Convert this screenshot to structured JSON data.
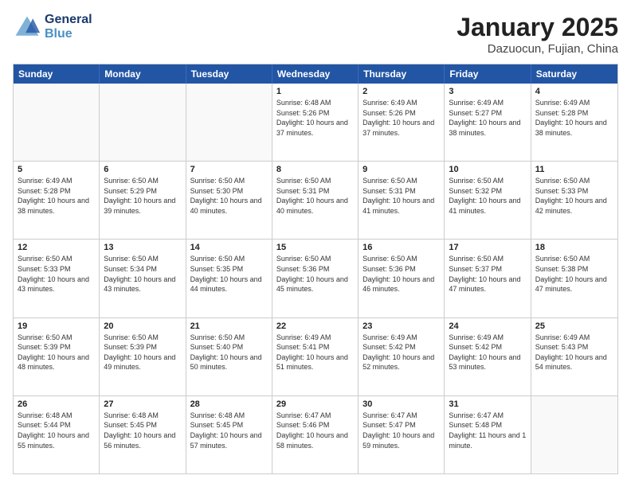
{
  "header": {
    "logo_general": "General",
    "logo_blue": "Blue",
    "title": "January 2025",
    "subtitle": "Dazuocun, Fujian, China"
  },
  "days_of_week": [
    "Sunday",
    "Monday",
    "Tuesday",
    "Wednesday",
    "Thursday",
    "Friday",
    "Saturday"
  ],
  "weeks": [
    [
      {
        "day": "",
        "sunrise": "",
        "sunset": "",
        "daylight": ""
      },
      {
        "day": "",
        "sunrise": "",
        "sunset": "",
        "daylight": ""
      },
      {
        "day": "",
        "sunrise": "",
        "sunset": "",
        "daylight": ""
      },
      {
        "day": "1",
        "sunrise": "Sunrise: 6:48 AM",
        "sunset": "Sunset: 5:26 PM",
        "daylight": "Daylight: 10 hours and 37 minutes."
      },
      {
        "day": "2",
        "sunrise": "Sunrise: 6:49 AM",
        "sunset": "Sunset: 5:26 PM",
        "daylight": "Daylight: 10 hours and 37 minutes."
      },
      {
        "day": "3",
        "sunrise": "Sunrise: 6:49 AM",
        "sunset": "Sunset: 5:27 PM",
        "daylight": "Daylight: 10 hours and 38 minutes."
      },
      {
        "day": "4",
        "sunrise": "Sunrise: 6:49 AM",
        "sunset": "Sunset: 5:28 PM",
        "daylight": "Daylight: 10 hours and 38 minutes."
      }
    ],
    [
      {
        "day": "5",
        "sunrise": "Sunrise: 6:49 AM",
        "sunset": "Sunset: 5:28 PM",
        "daylight": "Daylight: 10 hours and 38 minutes."
      },
      {
        "day": "6",
        "sunrise": "Sunrise: 6:50 AM",
        "sunset": "Sunset: 5:29 PM",
        "daylight": "Daylight: 10 hours and 39 minutes."
      },
      {
        "day": "7",
        "sunrise": "Sunrise: 6:50 AM",
        "sunset": "Sunset: 5:30 PM",
        "daylight": "Daylight: 10 hours and 40 minutes."
      },
      {
        "day": "8",
        "sunrise": "Sunrise: 6:50 AM",
        "sunset": "Sunset: 5:31 PM",
        "daylight": "Daylight: 10 hours and 40 minutes."
      },
      {
        "day": "9",
        "sunrise": "Sunrise: 6:50 AM",
        "sunset": "Sunset: 5:31 PM",
        "daylight": "Daylight: 10 hours and 41 minutes."
      },
      {
        "day": "10",
        "sunrise": "Sunrise: 6:50 AM",
        "sunset": "Sunset: 5:32 PM",
        "daylight": "Daylight: 10 hours and 41 minutes."
      },
      {
        "day": "11",
        "sunrise": "Sunrise: 6:50 AM",
        "sunset": "Sunset: 5:33 PM",
        "daylight": "Daylight: 10 hours and 42 minutes."
      }
    ],
    [
      {
        "day": "12",
        "sunrise": "Sunrise: 6:50 AM",
        "sunset": "Sunset: 5:33 PM",
        "daylight": "Daylight: 10 hours and 43 minutes."
      },
      {
        "day": "13",
        "sunrise": "Sunrise: 6:50 AM",
        "sunset": "Sunset: 5:34 PM",
        "daylight": "Daylight: 10 hours and 43 minutes."
      },
      {
        "day": "14",
        "sunrise": "Sunrise: 6:50 AM",
        "sunset": "Sunset: 5:35 PM",
        "daylight": "Daylight: 10 hours and 44 minutes."
      },
      {
        "day": "15",
        "sunrise": "Sunrise: 6:50 AM",
        "sunset": "Sunset: 5:36 PM",
        "daylight": "Daylight: 10 hours and 45 minutes."
      },
      {
        "day": "16",
        "sunrise": "Sunrise: 6:50 AM",
        "sunset": "Sunset: 5:36 PM",
        "daylight": "Daylight: 10 hours and 46 minutes."
      },
      {
        "day": "17",
        "sunrise": "Sunrise: 6:50 AM",
        "sunset": "Sunset: 5:37 PM",
        "daylight": "Daylight: 10 hours and 47 minutes."
      },
      {
        "day": "18",
        "sunrise": "Sunrise: 6:50 AM",
        "sunset": "Sunset: 5:38 PM",
        "daylight": "Daylight: 10 hours and 47 minutes."
      }
    ],
    [
      {
        "day": "19",
        "sunrise": "Sunrise: 6:50 AM",
        "sunset": "Sunset: 5:39 PM",
        "daylight": "Daylight: 10 hours and 48 minutes."
      },
      {
        "day": "20",
        "sunrise": "Sunrise: 6:50 AM",
        "sunset": "Sunset: 5:39 PM",
        "daylight": "Daylight: 10 hours and 49 minutes."
      },
      {
        "day": "21",
        "sunrise": "Sunrise: 6:50 AM",
        "sunset": "Sunset: 5:40 PM",
        "daylight": "Daylight: 10 hours and 50 minutes."
      },
      {
        "day": "22",
        "sunrise": "Sunrise: 6:49 AM",
        "sunset": "Sunset: 5:41 PM",
        "daylight": "Daylight: 10 hours and 51 minutes."
      },
      {
        "day": "23",
        "sunrise": "Sunrise: 6:49 AM",
        "sunset": "Sunset: 5:42 PM",
        "daylight": "Daylight: 10 hours and 52 minutes."
      },
      {
        "day": "24",
        "sunrise": "Sunrise: 6:49 AM",
        "sunset": "Sunset: 5:42 PM",
        "daylight": "Daylight: 10 hours and 53 minutes."
      },
      {
        "day": "25",
        "sunrise": "Sunrise: 6:49 AM",
        "sunset": "Sunset: 5:43 PM",
        "daylight": "Daylight: 10 hours and 54 minutes."
      }
    ],
    [
      {
        "day": "26",
        "sunrise": "Sunrise: 6:48 AM",
        "sunset": "Sunset: 5:44 PM",
        "daylight": "Daylight: 10 hours and 55 minutes."
      },
      {
        "day": "27",
        "sunrise": "Sunrise: 6:48 AM",
        "sunset": "Sunset: 5:45 PM",
        "daylight": "Daylight: 10 hours and 56 minutes."
      },
      {
        "day": "28",
        "sunrise": "Sunrise: 6:48 AM",
        "sunset": "Sunset: 5:45 PM",
        "daylight": "Daylight: 10 hours and 57 minutes."
      },
      {
        "day": "29",
        "sunrise": "Sunrise: 6:47 AM",
        "sunset": "Sunset: 5:46 PM",
        "daylight": "Daylight: 10 hours and 58 minutes."
      },
      {
        "day": "30",
        "sunrise": "Sunrise: 6:47 AM",
        "sunset": "Sunset: 5:47 PM",
        "daylight": "Daylight: 10 hours and 59 minutes."
      },
      {
        "day": "31",
        "sunrise": "Sunrise: 6:47 AM",
        "sunset": "Sunset: 5:48 PM",
        "daylight": "Daylight: 11 hours and 1 minute."
      },
      {
        "day": "",
        "sunrise": "",
        "sunset": "",
        "daylight": ""
      }
    ]
  ]
}
